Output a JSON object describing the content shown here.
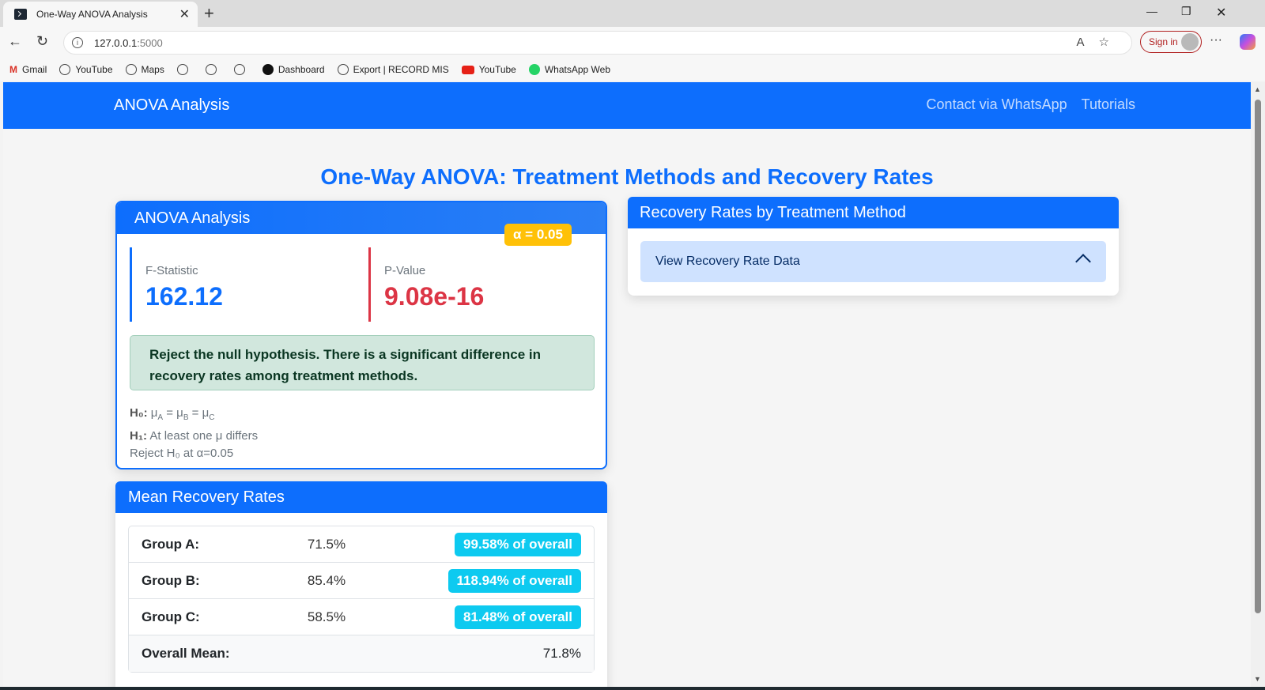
{
  "browser": {
    "tab_title": "One-Way ANOVA Analysis",
    "url_host": "127.0.0.1",
    "url_port": ":5000",
    "signin_label": "Sign in",
    "bookmarks": [
      "Gmail",
      "YouTube",
      "Maps",
      "Dashboard",
      "Export | RECORD MIS",
      "YouTube",
      "WhatsApp Web"
    ]
  },
  "navbar": {
    "brand": "ANOVA Analysis",
    "links": [
      "Contact via WhatsApp",
      "Tutorials"
    ]
  },
  "page": {
    "title": "One-Way ANOVA: Treatment Methods and Recovery Rates"
  },
  "anova": {
    "header": "ANOVA Analysis",
    "alpha_badge": "α = 0.05",
    "f_label": "F-Statistic",
    "f_value": "162.12",
    "p_label": "P-Value",
    "p_value": "9.08e-16",
    "decision": "Reject the null hypothesis. There is a significant difference in recovery rates among treatment methods.",
    "h0_label": "H₀:",
    "h1_label": "H₁:",
    "h1_text": "At least one μ differs",
    "reject_text": "Reject H₀ at α=0.05"
  },
  "means": {
    "header": "Mean Recovery Rates",
    "rows": [
      {
        "group": "Group A:",
        "mean": "71.5%",
        "badge": "99.58% of overall"
      },
      {
        "group": "Group B:",
        "mean": "85.4%",
        "badge": "118.94% of overall"
      },
      {
        "group": "Group C:",
        "mean": "58.5%",
        "badge": "81.48% of overall"
      }
    ],
    "overall_label": "Overall Mean:",
    "overall_value": "71.8%"
  },
  "rates": {
    "header": "Recovery Rates by Treatment Method",
    "accordion_label": "View Recovery Rate Data"
  },
  "colors": {
    "primary": "#0d6efd",
    "danger": "#dc3545",
    "warning": "#ffc107",
    "info": "#0dcaf0",
    "success_bg": "#d1e7dd"
  }
}
